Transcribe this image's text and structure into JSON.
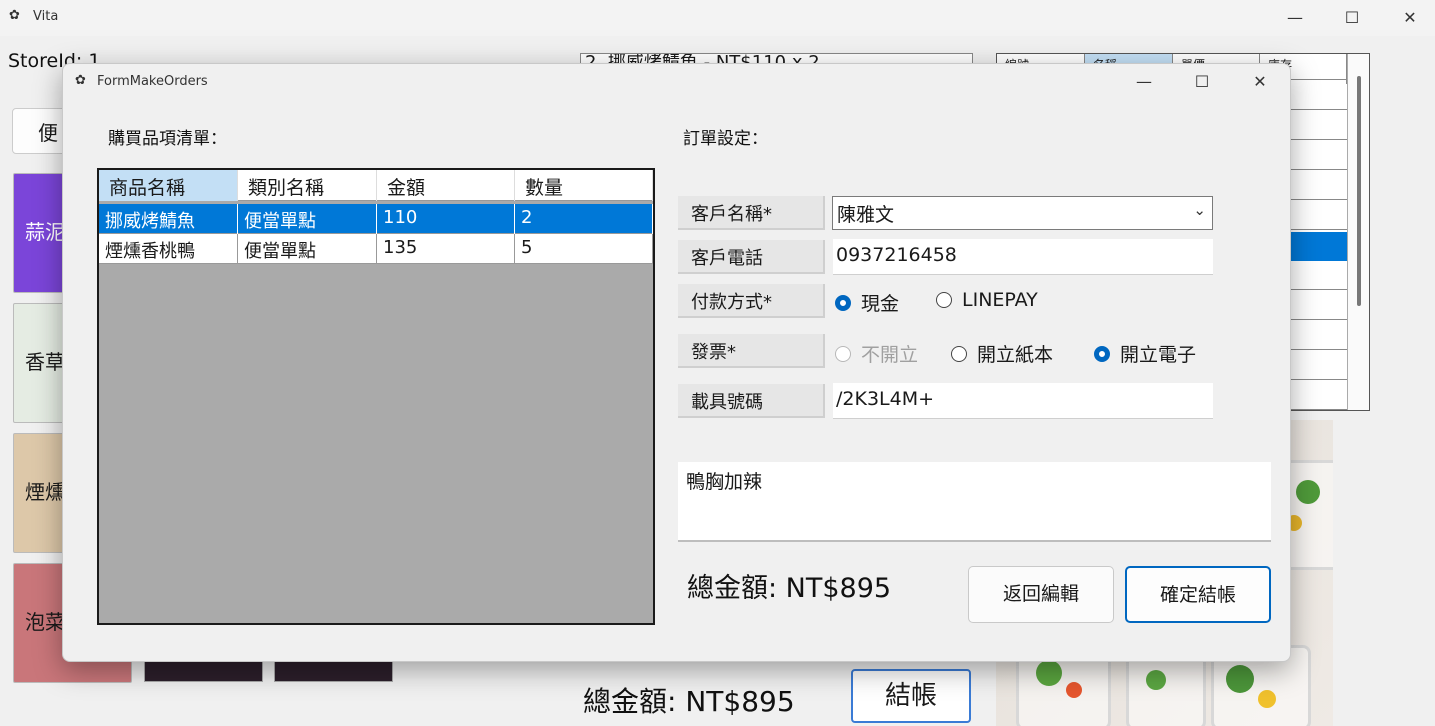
{
  "main_window": {
    "title": "Vita",
    "store_id_label": "StoreId: 1",
    "category_button": "便",
    "tiles": [
      {
        "label": "蒜泥",
        "color": "#7b45d9"
      },
      {
        "label": "香草",
        "color": "#e5ece3"
      },
      {
        "label": "煙燻",
        "color": "#ddc8a9"
      },
      {
        "label": "泡菜",
        "color": "#c9767a"
      }
    ],
    "list_partial_text": "2. 挪威烤鯖魚 - NT$110 x 2",
    "grid_headers": [
      "編號",
      "名稱",
      "單價",
      "庫存"
    ],
    "total_label": "總金額: NT$895",
    "checkout_button": "結帳",
    "controls": {
      "minimize": "—",
      "maximize": "☐",
      "close": "✕"
    }
  },
  "dialog": {
    "title": "FormMakeOrders",
    "controls": {
      "minimize": "—",
      "maximize": "☐",
      "close": "✕"
    },
    "items_heading": "購買品項清單：",
    "settings_heading": "訂單設定：",
    "grid": {
      "headers": [
        "商品名稱",
        "類別名稱",
        "金額",
        "數量"
      ],
      "rows": [
        {
          "name": "挪威烤鯖魚",
          "category": "便當單點",
          "amount": "110",
          "qty": "2",
          "selected": true
        },
        {
          "name": "煙燻香桃鴨",
          "category": "便當單點",
          "amount": "135",
          "qty": "5",
          "selected": false
        }
      ]
    },
    "fields": {
      "customer_name_label": "客戶名稱*",
      "customer_name_value": "陳雅文",
      "customer_phone_label": "客戶電話",
      "customer_phone_value": "0937216458",
      "payment_label": "付款方式*",
      "payment_options": [
        {
          "label": "現金",
          "checked": true
        },
        {
          "label": "LINEPAY",
          "checked": false
        }
      ],
      "invoice_label": "發票*",
      "invoice_options": [
        {
          "label": "不開立",
          "checked": false,
          "disabled": true
        },
        {
          "label": "開立紙本",
          "checked": false,
          "disabled": false
        },
        {
          "label": "開立電子",
          "checked": true,
          "disabled": false
        }
      ],
      "carrier_label": "載具號碼",
      "carrier_value": "/2K3L4M+"
    },
    "memo": "鴨胸加辣",
    "total_label": "總金額: NT$895",
    "back_button": "返回編輯",
    "confirm_button": "確定結帳"
  }
}
